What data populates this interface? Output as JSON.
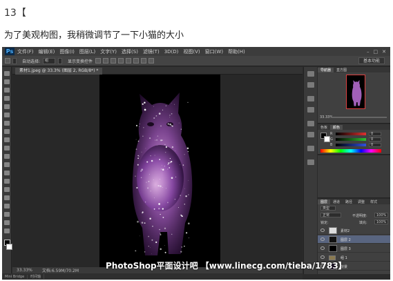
{
  "post": {
    "step": "13【",
    "caption": "为了美观构图，我稍微调节了一下小猫的大小"
  },
  "ps": {
    "logo": "Ps",
    "menu": [
      "文件(F)",
      "编辑(E)",
      "图像(I)",
      "图层(L)",
      "文字(Y)",
      "选择(S)",
      "滤镜(T)",
      "3D(D)",
      "视图(V)",
      "窗口(W)",
      "帮助(H)"
    ],
    "window_buttons": [
      "–",
      "□",
      "✕"
    ],
    "options": {
      "auto_select": "自动选择:",
      "auto_select_value": "组",
      "show_transform": "显示变换控件",
      "workspace": "基本功能"
    },
    "doc_tab": "素材1.jpeg @ 33.3% (图层 2, RGB/8*) *",
    "status": {
      "zoom": "33.33%",
      "doc_info": "文档:6.59M/70.2M"
    },
    "bottom_tabs": [
      "Mini Bridge",
      "时间轴"
    ],
    "navigator": {
      "tabs": [
        "导航器",
        "直方图"
      ],
      "zoom": "33.33%"
    },
    "color_panel": {
      "tabs": [
        "色板",
        "颜色"
      ],
      "rows": [
        {
          "label": "R",
          "value": "0",
          "color": "#e03030"
        },
        {
          "label": "G",
          "value": "0",
          "color": "#30c030"
        },
        {
          "label": "B",
          "value": "0",
          "color": "#3050e0"
        }
      ]
    },
    "layers_panel": {
      "tabs": [
        "图层",
        "通道",
        "路径",
        "调整",
        "样式"
      ],
      "kind": "类型",
      "blend_mode": "正常",
      "opacity_label": "不透明度:",
      "opacity": "100%",
      "lock_label": "锁定:",
      "fill_label": "填充:",
      "fill": "100%",
      "layers": [
        {
          "name": "素材2",
          "selected": false,
          "thumb": "#ddd"
        },
        {
          "name": "图层 2",
          "selected": true,
          "thumb": "#111"
        },
        {
          "name": "图层 3",
          "selected": false,
          "thumb": "#000"
        },
        {
          "name": "组 1",
          "selected": false,
          "thumb": "folder"
        },
        {
          "name": "背景",
          "selected": false,
          "thumb": "#1a1024"
        }
      ]
    }
  },
  "watermark": "PhotoShop平面设计吧 【www.linecg.com/tieba/1783】",
  "colors": {
    "ui_bg": "#2b2b2b",
    "panel": "#404040",
    "selected_layer": "#596580",
    "galaxy_pink": "#c070c0"
  }
}
